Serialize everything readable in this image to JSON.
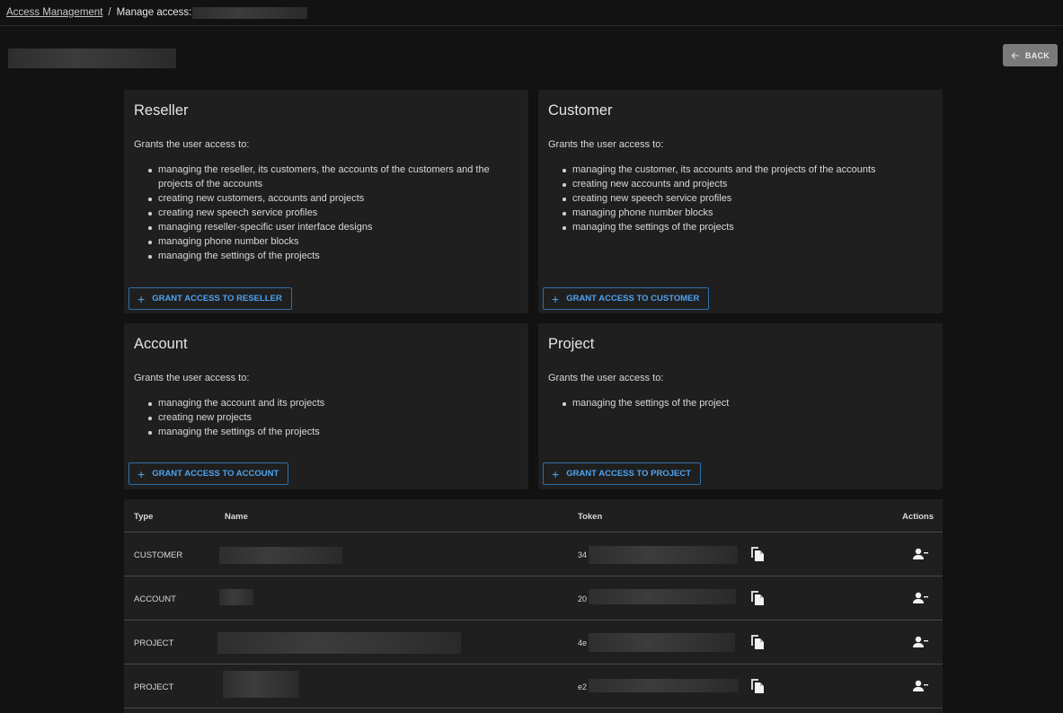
{
  "breadcrumb": {
    "parent": "Access Management",
    "separator": "/",
    "current": "Manage access:"
  },
  "header": {
    "back_label": "BACK",
    "back_icon": "arrow-left-icon"
  },
  "colors": {
    "background": "#121212",
    "card": "#1f1f1f",
    "accent": "#4ea3f0",
    "back_button": "#7a7a7a"
  },
  "cards": [
    {
      "title": "Reseller",
      "intro": "Grants the user access to:",
      "items": [
        "managing the reseller, its customers, the accounts of the customers and the projects of the accounts",
        "creating new customers, accounts and projects",
        "creating new speech service profiles",
        "managing reseller-specific user interface designs",
        "managing phone number blocks",
        "managing the settings of the projects"
      ],
      "button": "GRANT ACCESS TO RESELLER"
    },
    {
      "title": "Customer",
      "intro": "Grants the user access to:",
      "items": [
        "managing the customer, its accounts and the projects of the accounts",
        "creating new accounts and projects",
        "creating new speech service profiles",
        "managing phone number blocks",
        "managing the settings of the projects"
      ],
      "button": "GRANT ACCESS TO CUSTOMER"
    },
    {
      "title": "Account",
      "intro": "Grants the user access to:",
      "items": [
        "managing the account and its projects",
        "creating new projects",
        "managing the settings of the projects"
      ],
      "button": "GRANT ACCESS TO ACCOUNT"
    },
    {
      "title": "Project",
      "intro": "Grants the user access to:",
      "items": [
        "managing the settings of the project"
      ],
      "button": "GRANT ACCESS TO PROJECT"
    }
  ],
  "table": {
    "columns": [
      "Type",
      "Name",
      "Token",
      "Actions"
    ],
    "rows": [
      {
        "type": "CUSTOMER",
        "token_prefix": "34"
      },
      {
        "type": "ACCOUNT",
        "token_prefix": "20"
      },
      {
        "type": "PROJECT",
        "token_prefix": "4e"
      },
      {
        "type": "PROJECT",
        "token_prefix": "e2"
      }
    ]
  }
}
